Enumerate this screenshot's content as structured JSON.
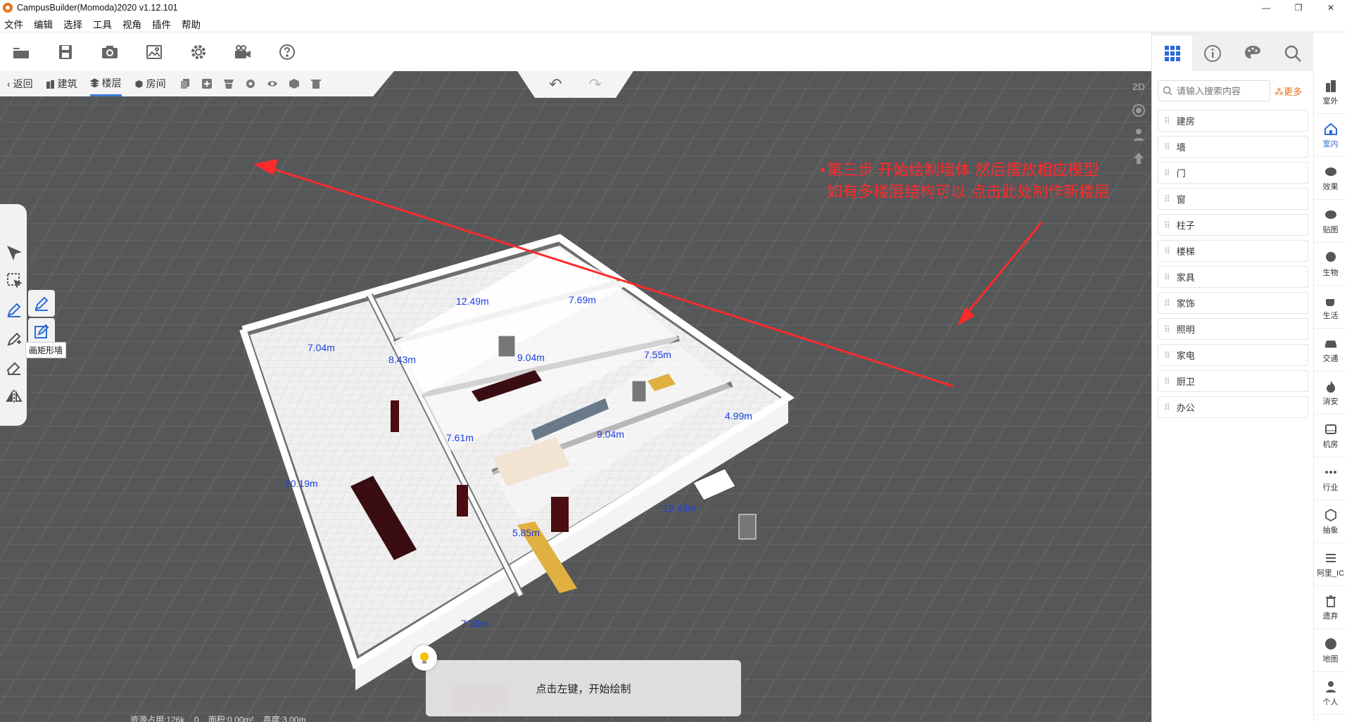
{
  "window": {
    "title": "CampusBuilder(Momoda)2020 v1.12.101",
    "controls": [
      "—",
      "❐",
      "✕"
    ]
  },
  "menu": [
    "文件",
    "编辑",
    "选择",
    "工具",
    "视角",
    "插件",
    "帮助"
  ],
  "subtabs": {
    "back": "返回",
    "building": "建筑",
    "floor": "楼层",
    "room": "房间"
  },
  "view_mode": "2D",
  "tooltip": "画矩形墙",
  "annotation": {
    "line1": "第三步 开始绘制墙体 然后摆放相应模型",
    "line2": "如有多楼层结构可以 点击此处制作新楼层"
  },
  "dimensions": [
    "12.49m",
    "7.69m",
    "7.04m",
    "8.43m",
    "9.04m",
    "7.55m",
    "7.61m",
    "4.99m",
    "9.04m",
    "20.19m",
    "5.85m",
    "12.43m",
    "7.16m"
  ],
  "hint": "点击左键，开始绘制",
  "status": {
    "resource": "资源占用:126k",
    "count": "0",
    "area": "面积:0.00m²",
    "height": "高度:3.00m"
  },
  "search": {
    "placeholder": "请输入搜索内容",
    "more": "更多"
  },
  "categories": [
    "建房",
    "墙",
    "门",
    "窗",
    "柱子",
    "楼梯",
    "家具",
    "家饰",
    "照明",
    "家电",
    "厨卫",
    "办公"
  ],
  "rail": [
    "室外",
    "室内",
    "效果",
    "贴图",
    "生物",
    "生活",
    "交通",
    "消安",
    "机房",
    "行业",
    "抽象",
    "阿里_IC",
    "遗弃",
    "地图",
    "个人"
  ],
  "colors": {
    "accent": "#2d6bd6",
    "annotation": "#ff2a2a",
    "more": "#e8731a",
    "grid_bg": "#555759",
    "dimension": "#1a3fe0"
  }
}
